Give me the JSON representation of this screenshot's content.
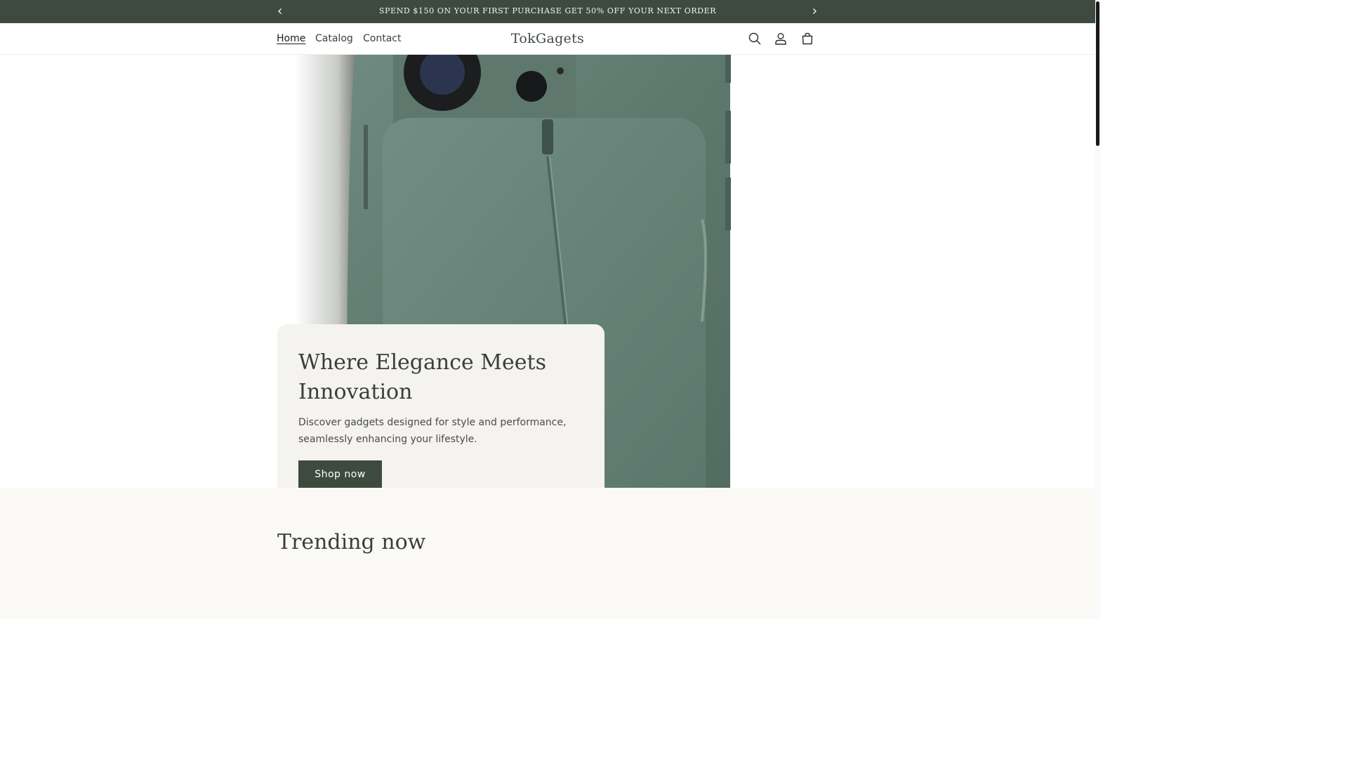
{
  "announcement": {
    "message": "SPEND $150 ON YOUR FIRST PURCHASE GET 50% OFF YOUR NEXT ORDER",
    "prev_icon": "chevron-left-icon",
    "next_icon": "chevron-right-icon"
  },
  "header": {
    "nav": [
      {
        "label": "Home",
        "active": true
      },
      {
        "label": "Catalog",
        "active": false
      },
      {
        "label": "Contact",
        "active": false
      }
    ],
    "logo": "TokGagets",
    "icons": [
      "search-icon",
      "account-icon",
      "cart-icon"
    ]
  },
  "hero": {
    "image": "green-phone-case-image",
    "heading": "Where Elegance Meets Innovation",
    "text": "Discover gadgets designed for style and performance, seamlessly enhancing your lifestyle.",
    "button_label": "Shop now"
  },
  "trending": {
    "heading": "Trending now"
  },
  "colors": {
    "brand": "#3f4a3e",
    "card_bg": "#f4f3ef",
    "section_bg": "#faf9f5"
  }
}
